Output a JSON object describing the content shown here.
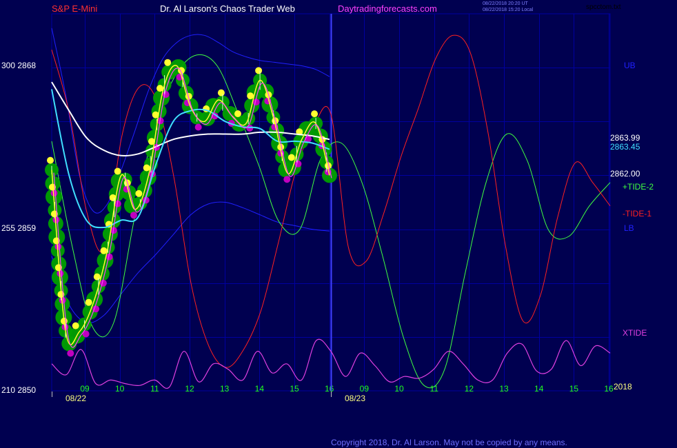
{
  "header": {
    "symbol": "S&P E-Mini",
    "site_title": "Dr. Al Larson's Chaos Trader Web",
    "site_url": "Daytradingforecasts.com",
    "timestamp_1": "08/22/2018 20:20 UT",
    "timestamp_2": "08/22/2018 15:20 Local",
    "filename": "spcctom.txt"
  },
  "labels": {
    "y_top_pair": "300  2868",
    "y_mid_pair": "255  2859",
    "y_bot_pair": "210  2850",
    "price_white": "2863.99",
    "price_cyan": "2863.45",
    "price_last": "2862.00",
    "ub": "UB",
    "tide2": "+TIDE-2",
    "tide1": "-TIDE-1",
    "lb": "LB",
    "xtide": "XTIDE",
    "year": "2018",
    "copyright": "Copyright 2018, Dr. Al Larson. May not be copied by any means."
  },
  "colors": {
    "background": "#000050",
    "grid": "#0000a0",
    "symbol": "#ff3030",
    "site_title": "#ffffff",
    "site_url": "#ff40ff",
    "ub_lb": "#2020ff",
    "tide_green": "#40ff40",
    "tide_red": "#ff2020",
    "xtide": "#e040e0",
    "white_line": "#ffffff",
    "cyan_line": "#40e0ff",
    "price_yellow": "#ffff30",
    "magenta_dot": "#c000c0",
    "green_band": "#00a000",
    "tick_text": "#20ff20",
    "date_text": "#ffff80"
  },
  "chart_data": {
    "type": "line",
    "title": "S&P E-Mini",
    "ylim": [
      2850,
      2871
    ],
    "y_ticks": [
      2850,
      2859,
      2868
    ],
    "x_time_ticks": [
      "09",
      "10",
      "11",
      "12",
      "13",
      "14",
      "15",
      "16",
      "09",
      "10",
      "11",
      "12",
      "13",
      "14",
      "15",
      "16"
    ],
    "x_date_ticks": [
      "08/22",
      "08/23"
    ],
    "last_values": {
      "white_ma": 2863.99,
      "cyan_ma": 2863.45,
      "price": 2862.0
    },
    "series": [
      {
        "name": "UB",
        "values": [
          2870.2,
          2866.5,
          2862.0,
          2860.0,
          2860.4,
          2862.3,
          2864.5,
          2866.8,
          2868.5,
          2869.4,
          2869.8,
          2869.8,
          2869.4,
          2868.9,
          2868.6,
          2868.4,
          2868.3,
          2868.2,
          2868.1,
          2867.9,
          2867.5
        ]
      },
      {
        "name": "LB",
        "values": [
          2857.5,
          2854.8,
          2853.8,
          2854.2,
          2855.4,
          2856.6,
          2857.6,
          2858.7,
          2859.8,
          2860.4,
          2860.5,
          2860.2,
          2859.8,
          2859.4,
          2859.2,
          2859.0,
          2858.9
        ]
      },
      {
        "name": "+TIDE-2",
        "values": [
          2863.9,
          2858.0,
          2853.5,
          2853.8,
          2859.6,
          2864.8,
          2867.6,
          2868.7,
          2868.1,
          2865.5,
          2862.6,
          2859.4,
          2859.0,
          2862.9,
          2863.8,
          2861.6,
          2857.5,
          2853.0,
          2850.3,
          2851.2,
          2856.6,
          2861.6,
          2864.3,
          2862.8,
          2859.0,
          2858.6,
          2860.3,
          2861.6
        ]
      },
      {
        "name": "-TIDE-1",
        "values": [
          2869.0,
          2865.5,
          2860.0,
          2857.9,
          2864.1,
          2866.9,
          2866.2,
          2861.9,
          2855.9,
          2852.5,
          2851.3,
          2852.3,
          2854.5,
          2858.3,
          2862.3,
          2864.7,
          2865.4,
          2858.0,
          2857.2,
          2859.8,
          2863.0,
          2865.7,
          2868.5,
          2869.8,
          2868.8,
          2864.4,
          2858.1,
          2853.9,
          2855.3,
          2859.7,
          2862.7,
          2861.6,
          2860.3
        ]
      },
      {
        "name": "XTIDE",
        "values": [
          2851.5,
          2850.9,
          2852.3,
          2850.4,
          2850.6,
          2850.4,
          2850.3,
          2850.6,
          2850.2,
          2852.2,
          2850.5,
          2851.5,
          2851.2,
          2850.6,
          2852.2,
          2851.0,
          2851.5,
          2850.6,
          2852.8,
          2852.2,
          2850.8,
          2852.1,
          2851.4,
          2850.5,
          2850.8,
          2850.7,
          2851.2,
          2852.2,
          2851.5,
          2850.6,
          2850.6,
          2852.1,
          2852.6,
          2851.1,
          2851.2,
          2852.8,
          2851.4,
          2852.5,
          2852.1
        ]
      },
      {
        "name": "White MA",
        "values": [
          2867.2,
          2865.6,
          2864.1,
          2863.4,
          2863.1,
          2863.2,
          2863.6,
          2864.0,
          2864.2,
          2864.3,
          2864.3,
          2864.3,
          2864.4,
          2864.4,
          2864.3,
          2864.2,
          2864.0
        ]
      },
      {
        "name": "Cyan MA",
        "values": [
          2866.8,
          2862.0,
          2859.5,
          2859.1,
          2859.5,
          2859.7,
          2862.6,
          2865.0,
          2865.6,
          2865.6,
          2865.0,
          2864.7,
          2864.6,
          2863.9,
          2863.9,
          2863.8,
          2863.45
        ]
      },
      {
        "name": "Price",
        "values": [
          2862.3,
          2853.3,
          2853.3,
          2854.9,
          2857.8,
          2862.0,
          2860.1,
          2862.1,
          2866.7,
          2868.1,
          2865.8,
          2865.0,
          2866.2,
          2865.3,
          2864.9,
          2867.3,
          2865.1,
          2862.1,
          2864.0,
          2864.9,
          2862.0
        ]
      }
    ]
  }
}
